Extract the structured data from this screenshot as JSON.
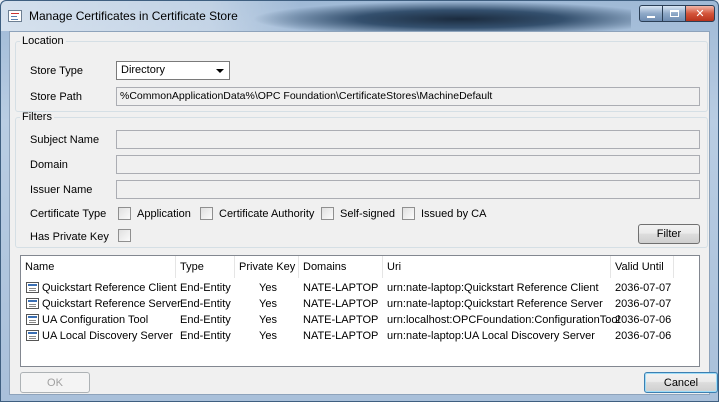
{
  "window": {
    "title": "Manage Certificates in Certificate Store"
  },
  "location": {
    "legend": "Location",
    "store_type_label": "Store Type",
    "store_type_value": "Directory",
    "store_path_label": "Store Path",
    "store_path_value": "%CommonApplicationData%\\OPC Foundation\\CertificateStores\\MachineDefault"
  },
  "filters": {
    "legend": "Filters",
    "subject_name_label": "Subject Name",
    "domain_label": "Domain",
    "issuer_name_label": "Issuer Name",
    "certificate_type_label": "Certificate Type",
    "type_options": [
      "Application",
      "Certificate Authority",
      "Self-signed",
      "Issued by CA"
    ],
    "has_private_key_label": "Has Private Key",
    "filter_button": "Filter"
  },
  "list": {
    "columns": [
      "Name",
      "Type",
      "Private Key",
      "Domains",
      "Uri",
      "Valid Until"
    ],
    "rows": [
      [
        "Quickstart Reference Client",
        "End-Entity",
        "Yes",
        "NATE-LAPTOP",
        "urn:nate-laptop:Quickstart Reference Client",
        "2036-07-07"
      ],
      [
        "Quickstart Reference Server",
        "End-Entity",
        "Yes",
        "NATE-LAPTOP",
        "urn:nate-laptop:Quickstart Reference Server",
        "2036-07-07"
      ],
      [
        "UA Configuration Tool",
        "End-Entity",
        "Yes",
        "NATE-LAPTOP",
        "urn:localhost:OPCFoundation:ConfigurationTool",
        "2036-07-06"
      ],
      [
        "UA Local Discovery Server",
        "End-Entity",
        "Yes",
        "NATE-LAPTOP",
        "urn:nate-laptop:UA Local Discovery Server",
        "2036-07-06"
      ]
    ]
  },
  "buttons": {
    "ok": "OK",
    "cancel": "Cancel"
  },
  "colors": {
    "titlebar": "#a9c0da",
    "close_button": "#d4553b",
    "client_bg": "#f0f0f0"
  },
  "icons": {
    "app": "certificate-app-icon",
    "row": "certificate-icon"
  }
}
